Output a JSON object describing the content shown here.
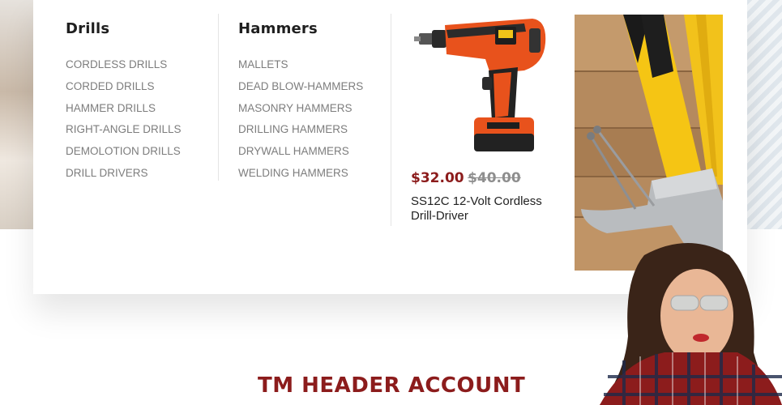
{
  "menu": {
    "columns": [
      {
        "title": "Drills",
        "items": [
          "CORDLESS DRILLS",
          "CORDED DRILLS",
          "HAMMER DRILLS",
          "RIGHT-ANGLE DRILLS",
          "DEMOLOTION DRILLS",
          "DRILL DRIVERS"
        ]
      },
      {
        "title": "Hammers",
        "items": [
          "MALLETS",
          "DEAD BLOW-HAMMERS",
          "MASONRY HAMMERS",
          "DRILLING HAMMERS",
          "DRYWALL HAMMERS",
          "WELDING HAMMERS"
        ]
      }
    ],
    "product": {
      "image_icon": "cordless-drill-image",
      "price_new": "$32.00",
      "price_old": "$40.00",
      "name": "SS12C 12-Volt Cordless Drill-Driver"
    },
    "banner": {
      "image_icon": "hammer-nails-tape-measure-image"
    }
  },
  "section": {
    "title": "TM HEADER ACCOUNT"
  },
  "colors": {
    "accent": "#8c1c1c",
    "price_old": "#8e8e8e",
    "link": "#7d7d7d",
    "heading": "#1f1f1f"
  }
}
